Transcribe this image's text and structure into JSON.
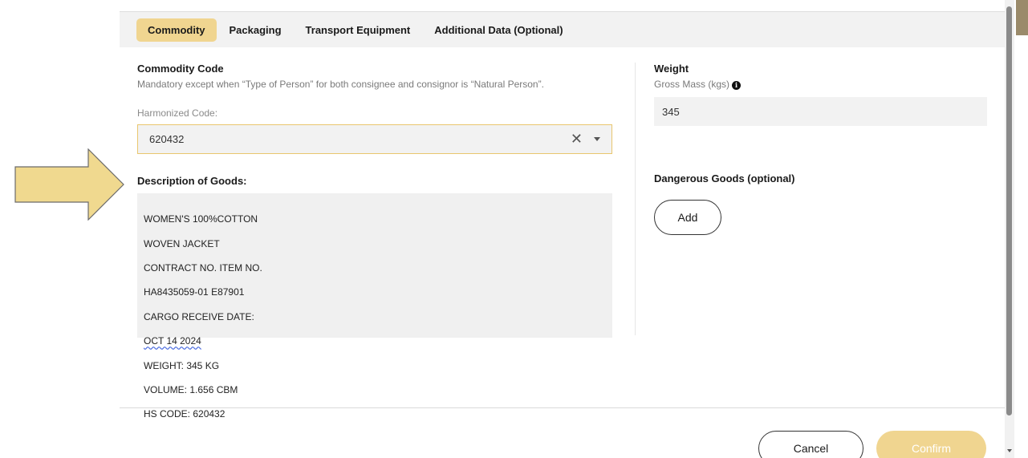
{
  "tabs": [
    {
      "label": "Commodity",
      "active": true
    },
    {
      "label": "Packaging",
      "active": false
    },
    {
      "label": "Transport Equipment",
      "active": false
    },
    {
      "label": "Additional Data (Optional)",
      "active": false
    }
  ],
  "commodity": {
    "title": "Commodity Code",
    "note": "Mandatory except when “Type of Person” for both consignee and consignor is “Natural Person”.",
    "harmonized_label": "Harmonized Code:",
    "harmonized_value": "620432",
    "clear_glyph": "✕"
  },
  "description": {
    "label": "Description of Goods:",
    "lines": [
      "WOMEN'S 100%COTTON",
      "WOVEN JACKET",
      "CONTRACT NO. ITEM NO.",
      "HA8435059-01 E87901",
      "CARGO RECEIVE DATE:",
      "OCT 14 2024",
      "WEIGHT: 345 KG",
      "VOLUME: 1.656 CBM",
      "HS CODE: 620432"
    ]
  },
  "weight": {
    "title": "Weight",
    "gross_label": "Gross Mass (kgs)",
    "gross_value": "345",
    "info_glyph": "i"
  },
  "dangerous": {
    "label": "Dangerous Goods (optional)",
    "add_label": "Add"
  },
  "footer": {
    "cancel_label": "Cancel",
    "confirm_label": "Confirm"
  },
  "colors": {
    "accent": "#f0d590",
    "field_bg": "#f2f2f2",
    "focus_border": "#e9c66e"
  },
  "icons": {
    "arrow": "arrow-right-icon",
    "clear": "close-icon",
    "caret": "chevron-down-icon",
    "info": "info-icon"
  }
}
